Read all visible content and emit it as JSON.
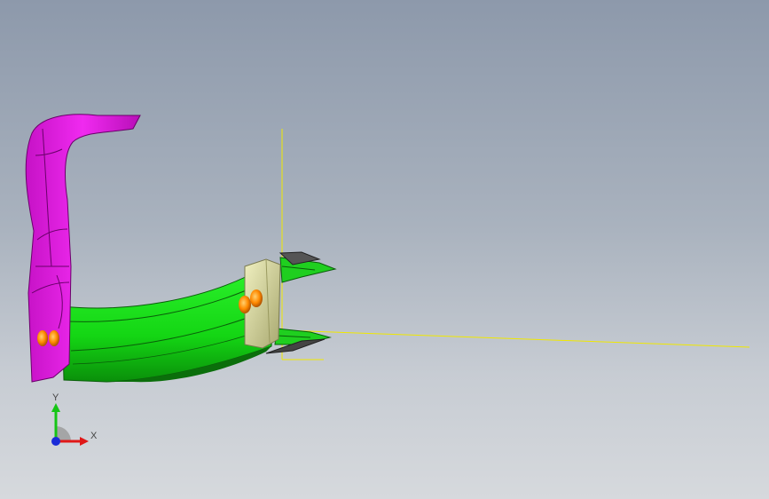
{
  "triad": {
    "x_label": "X",
    "y_label": "Y"
  },
  "colors": {
    "background_top": "#8d99ab",
    "background_bottom": "#d6d9dd",
    "handle_magenta": "#e81de8",
    "body_green": "#19e019",
    "body_green_dark": "#0c7a0c",
    "clip_beige": "#d8d89a",
    "rivet_orange": "#ff8a00",
    "axis_yellow": "#f0e800"
  },
  "icons": {
    "view_triad": "view-orientation-triad-icon"
  }
}
